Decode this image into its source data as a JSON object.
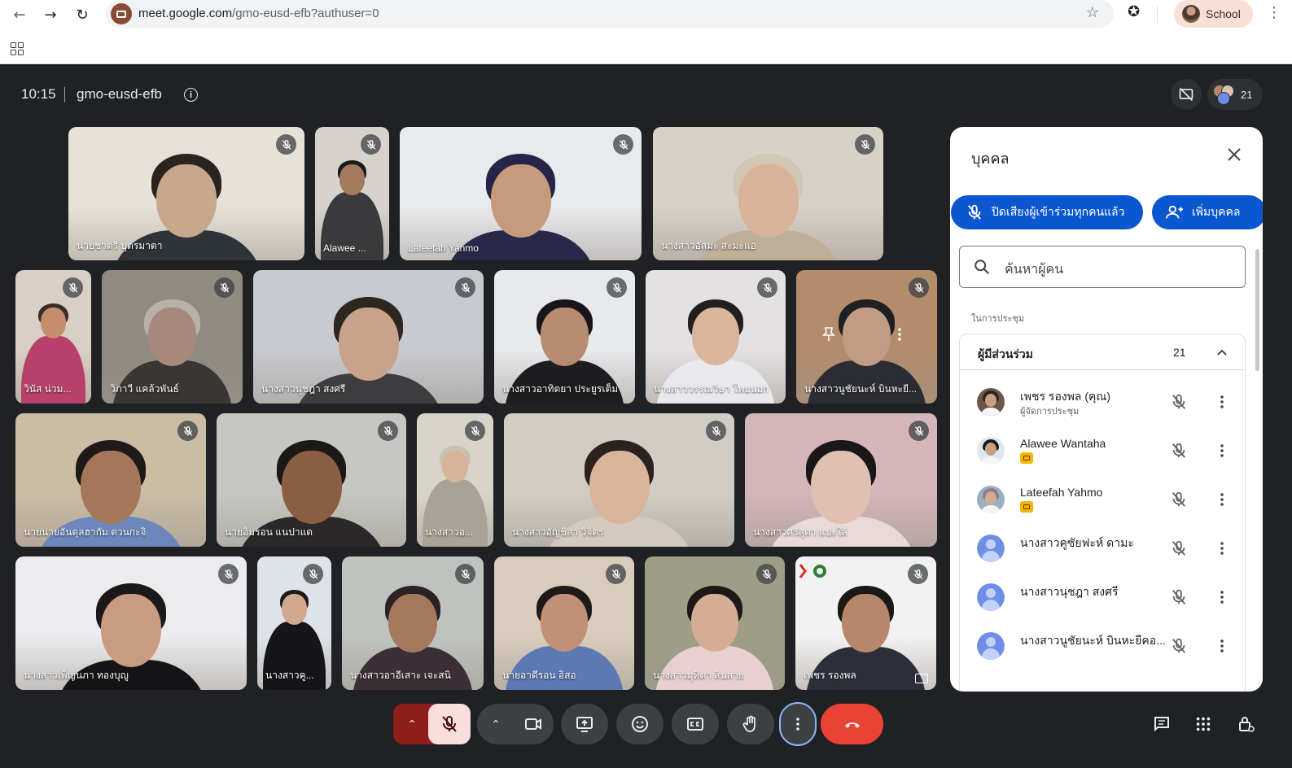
{
  "browser": {
    "url_host": "meet.google.com",
    "url_path": "/gmo-eusd-efb?authuser=0",
    "profile_label": "School",
    "icons": [
      "back-icon",
      "forward-icon",
      "reload-icon",
      "bookmark-star-icon",
      "extensions-star-icon",
      "kebab-menu-icon",
      "apps-grid-icon"
    ]
  },
  "meeting": {
    "time": "10:15",
    "code": "gmo-eusd-efb",
    "participant_count": "21"
  },
  "tiles": [
    {
      "name": "นายชาตรี บุตรมาตา"
    },
    {
      "name": "Alawee ..."
    },
    {
      "name": "Lateefah Yahmo"
    },
    {
      "name": "นางสาวอัสมะ สะมะแอ"
    },
    {
      "name": "วินัส น่วม..."
    },
    {
      "name": "วิภาวี แคล้วพันธ์"
    },
    {
      "name": "นางสาวนุชฎา สงศรี"
    },
    {
      "name": "นางสาวอาทิตยา ประยูรเต็ม"
    },
    {
      "name": "นางสาววรรณวิษา โพยนอก"
    },
    {
      "name": "นางสาวนูชัยนะห์ บินหะยี..."
    },
    {
      "name": "นายนายอันดุลฮากัม ตวนกะจิ"
    },
    {
      "name": "นายอิมรอน แนปาแด"
    },
    {
      "name": "นางสาวอ..."
    },
    {
      "name": "นางสาวอัญชิสา วิจิตร"
    },
    {
      "name": "นางสาวศรีสุดา แปะใส้"
    },
    {
      "name": "นางสาวเพ็ญนภา ทองบุญู"
    },
    {
      "name": "นางสาวคู..."
    },
    {
      "name": "นางสาวอาอีเสาะ เจะสนิ"
    },
    {
      "name": "นายอาดีรอน อิสอ"
    },
    {
      "name": "นางสาวมุทิตา สินสาย"
    },
    {
      "name": "เพชร รองพล"
    }
  ],
  "panel": {
    "title": "บุคคล",
    "mute_all_label": "ปิดเสียงผู้เข้าร่วมทุกคนแล้ว",
    "add_people_label": "เพิ่มบุคคล",
    "search_placeholder": "ค้นหาผู้คน",
    "section_label": "ในการประชุม",
    "group_title": "ผู้มีส่วนร่วม",
    "group_count": "21",
    "people": [
      {
        "name": "เพชร รองพล (คุณ)",
        "sub": "ผู้จัดการประชุม"
      },
      {
        "name": "Alawee Wantaha",
        "sub": ""
      },
      {
        "name": "Lateefah Yahmo",
        "sub": ""
      },
      {
        "name": "นางสาวคูซัยฟะห์ ดามะ",
        "sub": ""
      },
      {
        "name": "นางสาวนุชฎา สงศรี",
        "sub": ""
      },
      {
        "name": "นางสาวนูชัยนะห์ บินหะยีคอ...",
        "sub": ""
      }
    ]
  },
  "colors": {
    "background": "#202124",
    "end_call": "#ea4335",
    "mic_off_bg": "#f9dedc",
    "accent_blue": "#0b57d0",
    "active_ring": "#8ab4f8"
  }
}
